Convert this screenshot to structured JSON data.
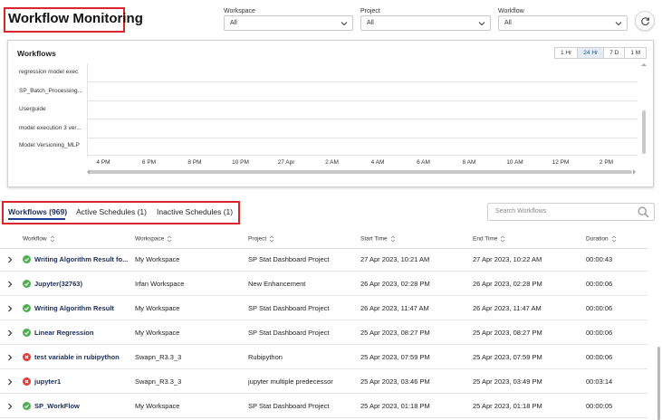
{
  "page_title": "Workflow Monitoring",
  "filters": {
    "workspace": {
      "label": "Workspace",
      "value": "All"
    },
    "project": {
      "label": "Project",
      "value": "All"
    },
    "workflow": {
      "label": "Workflow",
      "value": "All"
    }
  },
  "timeline": {
    "title": "Workflows",
    "ranges": [
      "1 Hr",
      "24 Hr",
      "7 D",
      "1 M"
    ],
    "active_range": "24 Hr",
    "rows": [
      "regression model exec",
      "SP_Batch_Processing...",
      "Userguide",
      "model execution 3 ver...",
      "Model Versioning_MLP"
    ],
    "x_ticks": [
      "4 PM",
      "6 PM",
      "8 PM",
      "10 PM",
      "27 Apr",
      "2 AM",
      "4 AM",
      "6 AM",
      "8 AM",
      "10 AM",
      "12 PM",
      "2 PM"
    ]
  },
  "tabs": [
    "Workflows (969)",
    "Active Schedules (1)",
    "Inactive Schedules (1)"
  ],
  "search": {
    "placeholder": "Search Workflows"
  },
  "table": {
    "columns": [
      "Workflow",
      "Workspace",
      "Project",
      "Start Time",
      "End Time",
      "Duration"
    ],
    "rows": [
      {
        "status": "success",
        "workflow": "Writing Algorithm Result fo...",
        "workspace": "My Workspace",
        "project": "SP Stat Dashboard Project",
        "start": "27 Apr 2023, 10:21 AM",
        "end": "27 Apr 2023, 10:22 AM",
        "duration": "00:00:43"
      },
      {
        "status": "success",
        "workflow": "Jupyter(32763)",
        "workspace": "Irfan Workspace",
        "project": "New Enhancement",
        "start": "26 Apr 2023, 02:28 PM",
        "end": "26 Apr 2023, 02:28 PM",
        "duration": "00:00:06"
      },
      {
        "status": "success",
        "workflow": "Writing Algorithm Result",
        "workspace": "My Workspace",
        "project": "SP Stat Dashboard Project",
        "start": "26 Apr 2023, 11:47 AM",
        "end": "26 Apr 2023, 11:47 AM",
        "duration": "00:00:06"
      },
      {
        "status": "success",
        "workflow": "Linear Regression",
        "workspace": "My Workspace",
        "project": "SP Stat Dashboard Project",
        "start": "25 Apr 2023, 08:27 PM",
        "end": "25 Apr 2023, 08:27 PM",
        "duration": "00:00:06"
      },
      {
        "status": "failed",
        "workflow": "test variable in rubipython",
        "workspace": "Swapn_R3.3_3",
        "project": "Rubipython",
        "start": "25 Apr 2023, 07:59 PM",
        "end": "25 Apr 2023, 07:59 PM",
        "duration": "00:00:06"
      },
      {
        "status": "failed",
        "workflow": "jupyter1",
        "workspace": "Swapn_R3.3_3",
        "project": "jupyter multiple predecessor",
        "start": "25 Apr 2023, 03:46 PM",
        "end": "25 Apr 2023, 03:49 PM",
        "duration": "00:03:14"
      },
      {
        "status": "success",
        "workflow": "SP_WorkFlow",
        "workspace": "My Workspace",
        "project": "SP Stat Dashboard Project",
        "start": "25 Apr 2023, 01:18 PM",
        "end": "25 Apr 2023, 01:18 PM",
        "duration": "00:00:05"
      }
    ]
  },
  "colors": {
    "success": "#4caf50",
    "failed": "#e53935",
    "accent": "#1d3f8f",
    "highlight_border": "#d9252b"
  }
}
